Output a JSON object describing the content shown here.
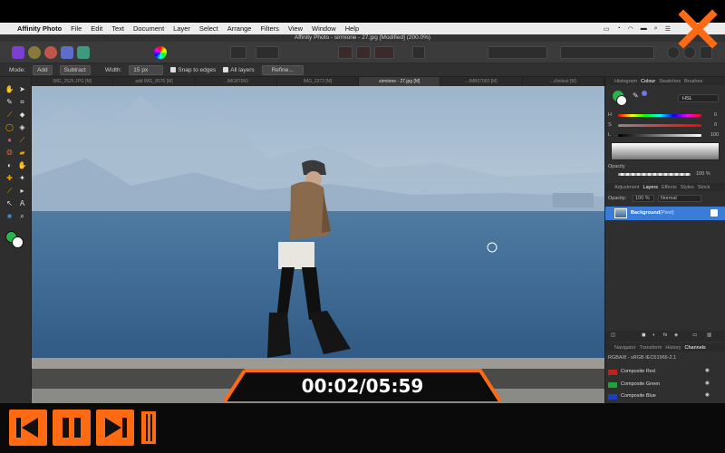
{
  "menubar": {
    "app_name": "Affinity Photo",
    "items": [
      "File",
      "Edit",
      "Text",
      "Document",
      "Layer",
      "Select",
      "Arrange",
      "Filters",
      "View",
      "Window",
      "Help"
    ]
  },
  "window": {
    "title": "Affinity Photo - sirmione - 27.jpg [Modified] (200.0%)"
  },
  "context": {
    "mode_label": "Mode:",
    "mode_add": "Add",
    "mode_subtract": "Subtract",
    "width_label": "Width:",
    "width_value": "15 px",
    "snap_label": "Snap to edges",
    "all_layers_label": "All layers",
    "refine_label": "Refine..."
  },
  "doc_tabs": [
    "IMG_2525.JPG [M]",
    "add IMG_8576 [M]",
    "...IMG87060",
    "IMG_2372 [M]",
    "sirmione - 27.jpg [M]",
    "...IMB07060 [M]",
    "...clinitest [M]"
  ],
  "panels": {
    "colour_tabs": [
      "Histogram",
      "Colour",
      "Swatches",
      "Brushes"
    ],
    "colour_active": "Colour",
    "colour_model": "HSL",
    "h_label": "H",
    "s_label": "S",
    "l_label": "L",
    "h_value": "0",
    "s_value": "0",
    "l_value": "100",
    "opacity_label": "Opacity",
    "opacity_value": "100 %",
    "layers_tabs": [
      "Adjustment",
      "Layers",
      "Effects",
      "Styles",
      "Stock"
    ],
    "layers_active": "Layers",
    "layer_opacity_label": "Opacity:",
    "layer_opacity_value": "100 %",
    "blend_mode": "Normal",
    "layer_name": "Background",
    "layer_type": "(Pixel)",
    "channels_tabs": [
      "Navigator",
      "Transform",
      "History",
      "Channels"
    ],
    "channels_active": "Channels",
    "colour_profile": "RGBA/8 - sRGB IEC61966-2.1",
    "channels": [
      {
        "name": "Composite Red",
        "color": "#c0221c"
      },
      {
        "name": "Composite Green",
        "color": "#1ea33a"
      },
      {
        "name": "Composite Blue",
        "color": "#1a3fbf"
      }
    ]
  },
  "video": {
    "timecode": "00:02/05:59",
    "accent": "#ff6a13"
  }
}
